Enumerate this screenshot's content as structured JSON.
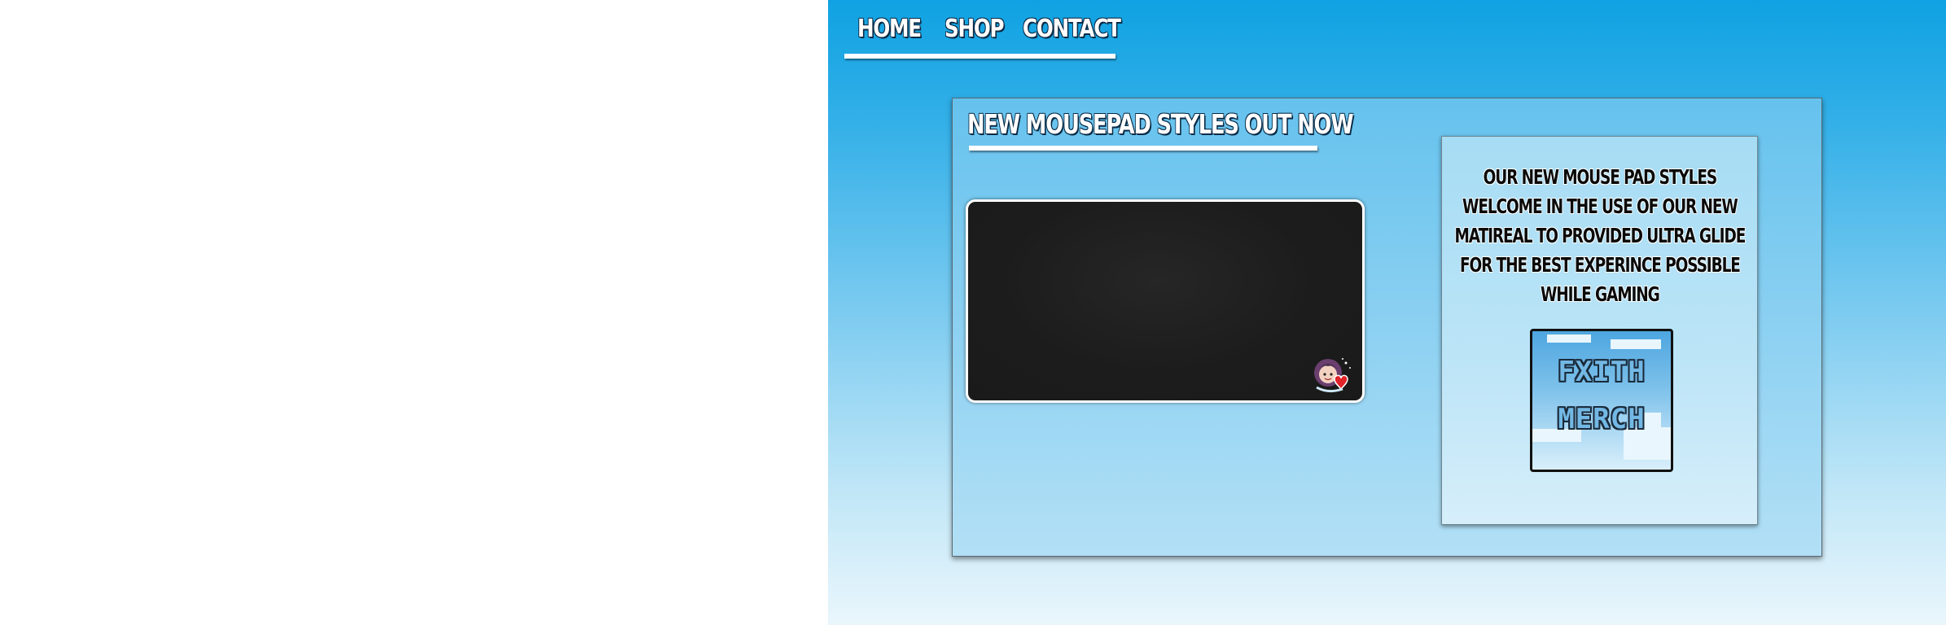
{
  "nav": {
    "items": [
      {
        "label": "HOME"
      },
      {
        "label": "SHOP"
      },
      {
        "label": "CONTACT"
      }
    ]
  },
  "main": {
    "title": "NEW MOUSEPAD STYLES OUT NOW",
    "description": "OUR NEW MOUSE PAD STYLES WELCOME IN THE USE OF OUR NEW MATIREAL TO PROVIDED ULTRA GLIDE FOR THE BEST EXPERINCE POSSIBLE WHILE GAMING",
    "merch_tile": {
      "line1": "FXITH",
      "line2": "MERCH"
    }
  },
  "colors": {
    "background_top": "#0fa2e2",
    "background_bottom": "#eaf6fc",
    "mousepad": "#1c1c1c",
    "nav_text": "#ffffff"
  },
  "icons": {
    "mousepad_logo": "avatar-heart-logo"
  }
}
